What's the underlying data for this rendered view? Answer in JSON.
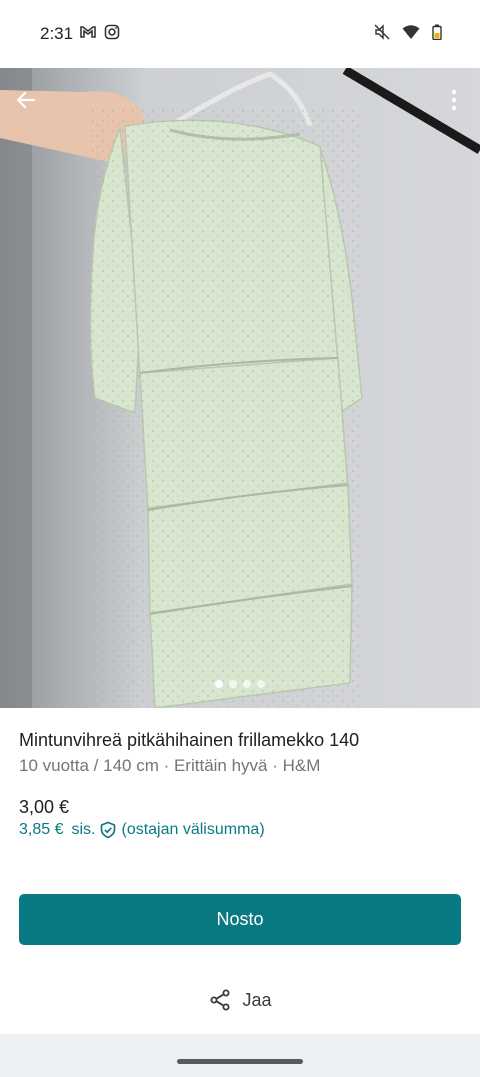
{
  "status_bar": {
    "time": "2:31",
    "left_icons": [
      "gmail-icon",
      "instagram-icon"
    ],
    "right_icons": [
      "mute-icon",
      "wifi-icon",
      "battery-icon"
    ]
  },
  "gallery": {
    "image_count": 4,
    "active_index": 0
  },
  "item": {
    "title": "Mintunvihreä pitkähihainen frillamekko 140",
    "details": "10 vuotta / 140 cm · Erittäin hyvä · H&M",
    "price": "3,00 €",
    "buyer_price": "3,85 €",
    "buyer_price_incl": "sis.",
    "buyer_price_note": "(ostajan välisumma)"
  },
  "actions": {
    "buy_label": "Nosto",
    "share_label": "Jaa"
  },
  "colors": {
    "accent": "#0a7a82",
    "dress": "#d6e3cc"
  }
}
